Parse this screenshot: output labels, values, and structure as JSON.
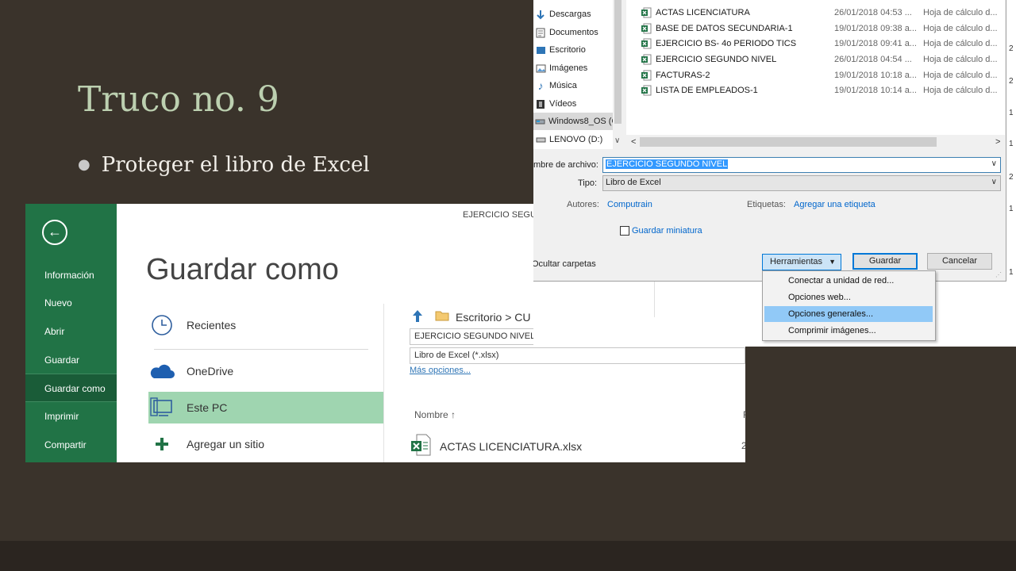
{
  "slide": {
    "title": "Truco no. 9",
    "bullet": "Proteger el libro de Excel"
  },
  "backstage": {
    "back_icon": "back-arrow-icon",
    "nav": [
      {
        "label": "Información"
      },
      {
        "label": "Nuevo"
      },
      {
        "label": "Abrir"
      },
      {
        "label": "Guardar"
      },
      {
        "label": "Guardar como"
      },
      {
        "label": "Imprimir"
      },
      {
        "label": "Compartir"
      }
    ],
    "document_name": "EJERCICIO SEGUNDO",
    "heading": "Guardar como",
    "locations": [
      {
        "label": "Recientes",
        "icon": "clock-icon"
      },
      {
        "label": "OneDrive",
        "icon": "cloud-icon"
      },
      {
        "label": "Este PC",
        "icon": "computer-icon"
      },
      {
        "label": "Agregar un sitio",
        "icon": "plus-icon"
      }
    ],
    "path": "Escritorio > CU",
    "filename": "EJERCICIO SEGUNDO NIVEL",
    "filetype": "Libro de Excel (*.xlsx)",
    "more_options": "Más opciones...",
    "column_name": "Nombre",
    "column_second_fragment": "F",
    "file": "ACTAS LICENCIATURA.xlsx",
    "file_date_fragment": "2"
  },
  "dialog": {
    "nav_items": [
      {
        "label": "Descargas",
        "icon": "download-arrow-icon"
      },
      {
        "label": "Documentos",
        "icon": "documents-icon"
      },
      {
        "label": "Escritorio",
        "icon": "desktop-icon"
      },
      {
        "label": "Imágenes",
        "icon": "pictures-icon"
      },
      {
        "label": "Música",
        "icon": "music-note-icon"
      },
      {
        "label": "Vídeos",
        "icon": "film-icon"
      },
      {
        "label": "Windows8_OS (C",
        "icon": "drive-icon"
      },
      {
        "label": "LENOVO (D:)",
        "icon": "drive-icon"
      }
    ],
    "files": [
      {
        "name": "ACTAS LICENCIATURA",
        "date": "26/01/2018 04:53 ...",
        "type": "Hoja de cálculo d..."
      },
      {
        "name": "BASE DE DATOS SECUNDARIA-1",
        "date": "19/01/2018 09:38 a...",
        "type": "Hoja de cálculo d..."
      },
      {
        "name": "EJERCICIO BS- 4o PERIODO TICS",
        "date": "19/01/2018 09:41 a...",
        "type": "Hoja de cálculo d..."
      },
      {
        "name": "EJERCICIO SEGUNDO NIVEL",
        "date": "26/01/2018 04:54 ...",
        "type": "Hoja de cálculo d..."
      },
      {
        "name": "FACTURAS-2",
        "date": "19/01/2018 10:18 a...",
        "type": "Hoja de cálculo d..."
      },
      {
        "name": "LISTA DE EMPLEADOS-1",
        "date": "19/01/2018 10:14 a...",
        "type": "Hoja de cálculo d..."
      }
    ],
    "filename_label": "mbre de archivo:",
    "filename_value": "EJERCICIO SEGUNDO NIVEL",
    "type_label": "Tipo:",
    "type_value": "Libro de Excel",
    "authors_label": "Autores:",
    "authors_value": "Computrain",
    "tags_label": "Etiquetas:",
    "tags_value": "Agregar una etiqueta",
    "thumbnail_label": "Guardar miniatura",
    "hide_folders": "Ocultar carpetas",
    "tools_button": "Herramientas",
    "save_button": "Guardar",
    "cancel_button": "Cancelar",
    "tools_menu": [
      {
        "label": "Conectar a unidad de red..."
      },
      {
        "label": "Opciones web..."
      },
      {
        "label": "Opciones generales..."
      },
      {
        "label": "Comprimir imágenes..."
      }
    ],
    "right_edge_fragments": [
      "2",
      "2",
      "1",
      "1",
      "2",
      "1",
      "1"
    ]
  }
}
